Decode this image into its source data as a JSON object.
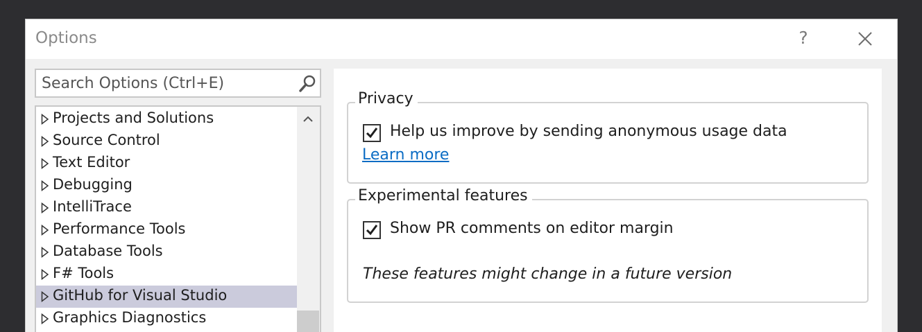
{
  "dialog": {
    "title": "Options",
    "help_label": "?"
  },
  "search": {
    "placeholder": "Search Options (Ctrl+E)"
  },
  "tree": {
    "items": [
      {
        "label": "Projects and Solutions",
        "selected": false
      },
      {
        "label": "Source Control",
        "selected": false
      },
      {
        "label": "Text Editor",
        "selected": false
      },
      {
        "label": "Debugging",
        "selected": false
      },
      {
        "label": "IntelliTrace",
        "selected": false
      },
      {
        "label": "Performance Tools",
        "selected": false
      },
      {
        "label": "Database Tools",
        "selected": false
      },
      {
        "label": "F# Tools",
        "selected": false
      },
      {
        "label": "GitHub for Visual Studio",
        "selected": true
      },
      {
        "label": "Graphics Diagnostics",
        "selected": false
      }
    ]
  },
  "privacy": {
    "legend": "Privacy",
    "checkbox_label": "Help us improve by sending anonymous usage data",
    "checked": true,
    "link_label": "Learn more"
  },
  "experimental": {
    "legend": "Experimental features",
    "checkbox_label": "Show PR comments on editor margin",
    "checked": true,
    "note": "These features might change in a future version"
  },
  "colors": {
    "selection": "#cbcbdc",
    "link": "#0b6cc4",
    "background": "#2d2d30"
  }
}
